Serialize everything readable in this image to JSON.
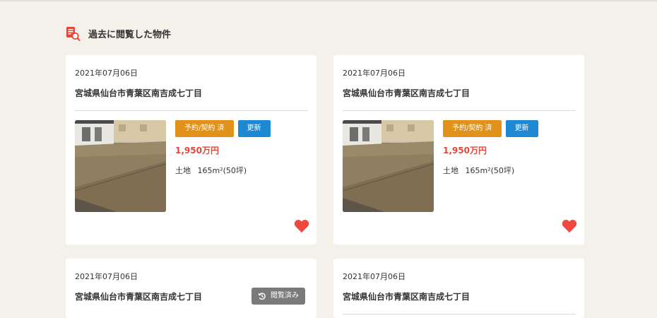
{
  "section": {
    "title": "過去に閲覧した物件",
    "icon": "history-search-icon"
  },
  "cards": [
    {
      "date": "2021年07月06日",
      "address": "宮城県仙台市青葉区南吉成七丁目",
      "status_badge": "予約/契約 済",
      "updated_badge": "更新",
      "price": "1,950万円",
      "property_type": "土地",
      "area": "165m²(50坪)",
      "favorite_icon": "heart-icon",
      "favorite_color": "#f0483e"
    },
    {
      "date": "2021年07月06日",
      "address": "宮城県仙台市青葉区南吉成七丁目",
      "status_badge": "予約/契約 済",
      "updated_badge": "更新",
      "price": "1,950万円",
      "property_type": "土地",
      "area": "165m²(50坪)",
      "favorite_icon": "heart-icon",
      "favorite_color": "#f0483e"
    },
    {
      "date": "2021年07月06日",
      "address": "宮城県仙台市青葉区南吉成七丁目",
      "viewed_badge": "閲覧済み",
      "viewed_icon": "history-icon"
    },
    {
      "date": "2021年07月06日",
      "address": "宮城県仙台市青葉区南吉成七丁目"
    }
  ],
  "colors": {
    "background": "#f4f1ea",
    "status_badge": "#e0921b",
    "updated_badge": "#1e88d2",
    "price": "#e5463a",
    "viewed_badge": "#7a7a7a"
  }
}
